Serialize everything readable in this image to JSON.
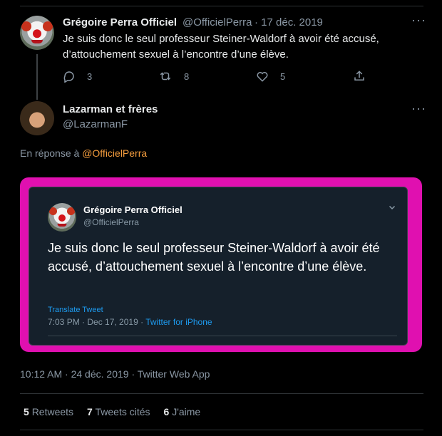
{
  "parent_tweet": {
    "author_name": "Grégoire Perra Officiel",
    "author_handle": "@OfficielPerra",
    "date": "· 17 déc. 2019",
    "text": "Je suis donc le seul professeur Steiner-Waldorf à avoir été accusé, d’attouchement sexuel à l’encontre d’une élève.",
    "replies": "3",
    "retweets": "8",
    "likes": "5"
  },
  "main_tweet": {
    "author_name": "Lazarman et frères",
    "author_handle": "@LazarmanF",
    "reply_prefix": "En réponse à",
    "reply_mention": "@OfficielPerra",
    "timestamp": "10:12 AM · 24 déc. 2019 · Twitter Web App",
    "stats": {
      "retweets_count": "5",
      "retweets_label": "Retweets",
      "quotes_count": "7",
      "quotes_label": "Tweets cités",
      "likes_count": "6",
      "likes_label": "J'aime"
    }
  },
  "embedded_tweet": {
    "author_name": "Grégoire Perra Officiel",
    "author_handle": "@OfficielPerra",
    "text": "Je suis donc le seul professeur Steiner-Waldorf à avoir été accusé, d’attouchement sexuel à l’encontre d’une élève.",
    "translate_label": "Translate Tweet",
    "time": "7:03 PM · Dec 17, 2019 · ",
    "source": "Twitter for iPhone"
  },
  "colors": {
    "highlight_frame": "#e010b0",
    "mention": "#f39c3d",
    "link_blue": "#1d9bf0"
  }
}
